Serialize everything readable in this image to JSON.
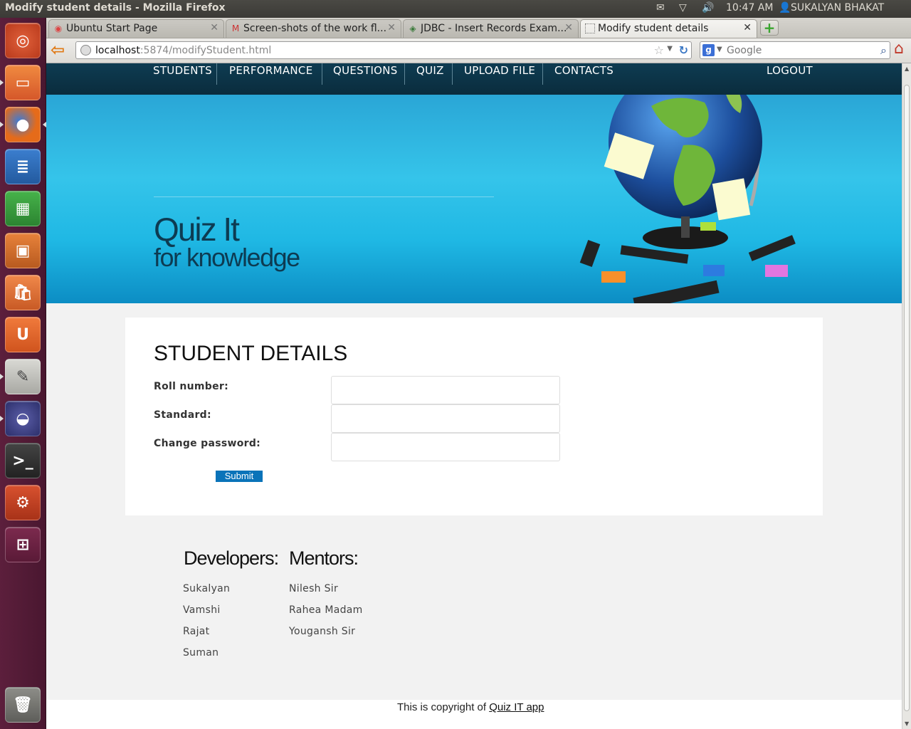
{
  "system": {
    "window_title": "Modify student details - Mozilla Firefox",
    "time": "10:47 AM",
    "user": "SUKALYAN BHAKAT"
  },
  "launcher": {
    "items": [
      "ubuntu-dash",
      "files",
      "firefox",
      "libreoffice-writer",
      "libreoffice-calc",
      "libreoffice-impress",
      "ubuntu-software-center",
      "ubuntu-one",
      "text-editor",
      "eclipse",
      "terminal",
      "system-settings",
      "workspace-switcher",
      "trash"
    ]
  },
  "tabs": [
    {
      "label": "Ubuntu Start Page",
      "icon": "ubuntu-page-icon"
    },
    {
      "label": "Screen-shots of the work fl...",
      "icon": "gmail-icon"
    },
    {
      "label": "JDBC - Insert Records Exam...",
      "icon": "tutorial-icon"
    },
    {
      "label": "Modify student details",
      "icon": "blank-page-icon"
    }
  ],
  "address": {
    "host": "localhost",
    "path": ":5874/modifyStudent.html"
  },
  "search": {
    "engine": "Google",
    "placeholder": "Google"
  },
  "site_nav": {
    "items": [
      "STUDENTS",
      "PERFORMANCE",
      "QUESTIONS",
      "QUIZ",
      "UPLOAD FILE",
      "CONTACTS"
    ],
    "logout": "LOGOUT"
  },
  "brand": {
    "title": "Quiz It",
    "subtitle": "for knowledge"
  },
  "form": {
    "heading": "STUDENT DETAILS",
    "fields": [
      {
        "label": "Roll number:",
        "value": ""
      },
      {
        "label": "Standard:",
        "value": ""
      },
      {
        "label": "Change password:",
        "value": ""
      }
    ],
    "submit": "Submit"
  },
  "footer": {
    "developers_title": "Developers:",
    "developers": [
      "Sukalyan",
      "Vamshi",
      "Rajat",
      "Suman"
    ],
    "mentors_title": "Mentors:",
    "mentors": [
      "Nilesh Sir",
      "Rahea Madam",
      "Yougansh Sir"
    ],
    "copyright_prefix": "This is copyright of",
    "copyright_link": "Quiz IT app"
  },
  "colors": {
    "site_nav_bg": "#0e3c52",
    "hero_blue": "#1fb8e4",
    "submit_bg": "#0a73b9",
    "launcher_bg": "#5c1f3c"
  }
}
